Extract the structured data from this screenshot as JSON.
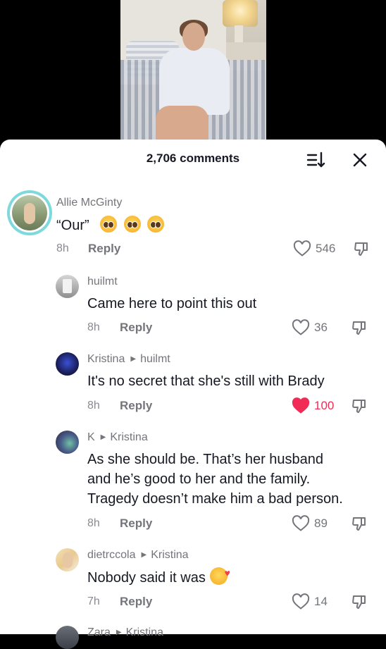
{
  "header": {
    "comments_count": "2,706 comments"
  },
  "comments": [
    {
      "author": "Allie McGinty",
      "reply_to": "",
      "text": "“Our”",
      "emoji_count": 3,
      "time": "8h",
      "reply_label": "Reply",
      "likes": "546",
      "liked": false
    },
    {
      "author": "huilmt",
      "reply_to": "",
      "text": "Came here to point this out",
      "time": "8h",
      "reply_label": "Reply",
      "likes": "36",
      "liked": false
    },
    {
      "author": "Kristina",
      "reply_to": "huilmt",
      "text": "It's no secret that she's still with Brady",
      "time": "8h",
      "reply_label": "Reply",
      "likes": "100",
      "liked": true
    },
    {
      "author": "K",
      "reply_to": "Kristina",
      "text_lines": [
        "As she should be. That’s her husband",
        "and he’s good to her and the family.",
        "Tragedy doesn’t make him a bad person."
      ],
      "time": "8h",
      "reply_label": "Reply",
      "likes": "89",
      "liked": false
    },
    {
      "author": "dietrccola",
      "reply_to": "Kristina",
      "text": "Nobody said it was",
      "time": "7h",
      "reply_label": "Reply",
      "likes": "14",
      "liked": false
    },
    {
      "author": "Zara",
      "reply_to": "Kristina"
    }
  ],
  "colors": {
    "like_active": "#f02c56",
    "text": "#161823",
    "muted": "#73757a"
  }
}
